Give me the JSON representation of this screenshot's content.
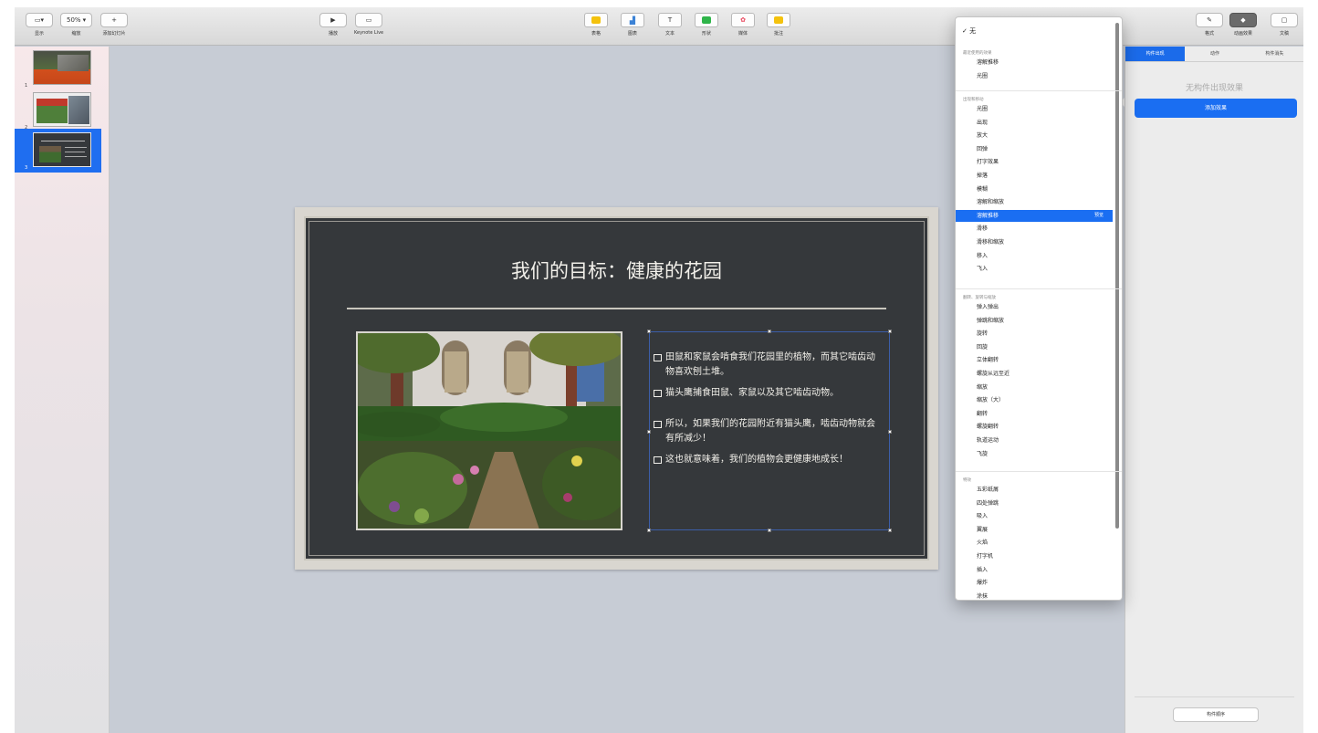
{
  "toolbar": {
    "view_label": "显示",
    "zoom_value": "50%",
    "zoom_label": "缩放",
    "add_slide_label": "添加幻灯片",
    "play_label": "播放",
    "keynote_live_label": "Keynote Live",
    "table_label": "表格",
    "chart_label": "图表",
    "text_label": "文本",
    "shape_label": "形状",
    "media_label": "媒体",
    "comment_label": "批注",
    "format_label": "格式",
    "animate_label": "动画效果",
    "document_label": "文稿",
    "colors": {
      "table": "#f4c20d",
      "chart": "#3b82d6",
      "shape": "#2fb54a",
      "comment": "#f4c20d"
    }
  },
  "navigator": {
    "slides": [
      {
        "number": "1"
      },
      {
        "number": "2"
      },
      {
        "number": "3"
      }
    ]
  },
  "slide": {
    "title": "我们的目标：健康的花园",
    "bullets": [
      "田鼠和家鼠会啃食我们花园里的植物，而其它啮齿动物喜欢刨土堆。",
      "猫头鹰捕食田鼠、家鼠以及其它啮齿动物。",
      "所以，如果我们的花园附近有猫头鹰，啮齿动物就会有所减少！",
      "这也就意味着，我们的植物会更健康地成长！"
    ]
  },
  "menu": {
    "none_label": "无",
    "recent_header": "最近使用的效果",
    "recent_items": [
      "溶解推移",
      "光圈"
    ],
    "appear_header": "出现和移动",
    "appear_items": [
      "光圈",
      "出现",
      "放大",
      "回弹",
      "打字效果",
      "掉落",
      "模糊",
      "溶解和缩放",
      "溶解推移",
      "滑移",
      "滑移和缩放",
      "移入",
      "飞入"
    ],
    "highlighted_index": 8,
    "preview_label": "预览",
    "flip_header": "翻转、旋转与缩放",
    "flip_items": [
      "弹入弹出",
      "弹跳和缩放",
      "旋转",
      "回旋",
      "立体翻转",
      "螺旋从远至近",
      "缩放",
      "缩放（大）",
      "翻转",
      "螺旋翻转",
      "轨道运动",
      "飞旋"
    ],
    "fx_header": "特效",
    "fx_items": [
      "五彩纸屑",
      "四处弹跳",
      "吸入",
      "翼展",
      "火焰",
      "打字机",
      "插入",
      "爆炸",
      "涂抹"
    ]
  },
  "inspector": {
    "tabs": [
      "构件出现",
      "动作",
      "构件消失"
    ],
    "active_tab": 0,
    "empty_text": "无构件出现效果",
    "add_effect_label": "添加效果",
    "order_label": "构件顺序"
  }
}
